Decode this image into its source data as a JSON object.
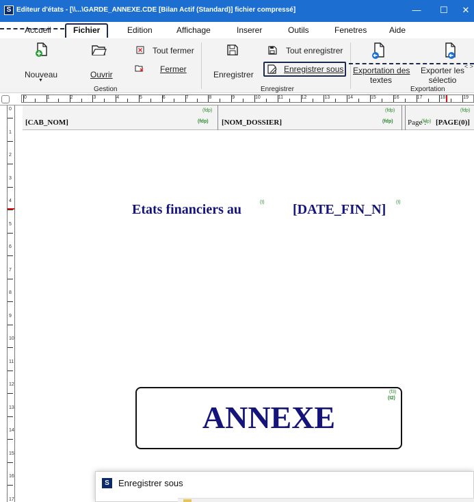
{
  "window": {
    "app_icon": "S",
    "title": "Editeur d'états - [\\\\...\\GARDE_ANNEXE.CDE [Bilan Actif (Standard)] fichier compressé]",
    "minimize": "—",
    "maximize": "☐",
    "close": "✕"
  },
  "menu": [
    "Accueil",
    "Fichier",
    "Edition",
    "Affichage",
    "Inserer",
    "Outils",
    "Fenetres",
    "Aide"
  ],
  "menu_active": "Fichier",
  "ribbon": {
    "gestion": {
      "nouveau": "Nouveau",
      "ouvrir": "Ouvrir",
      "tout_fermer": "Tout fermer",
      "fermer": "Fermer",
      "label": "Gestion"
    },
    "enregistrer": {
      "enregistrer": "Enregistrer",
      "tout_enregistrer": "Tout enregistrer",
      "enregistrer_sous": "Enregistrer sous",
      "label": "Enregistrer"
    },
    "exportation": {
      "exportation_des_textes_l1": "Exportation des",
      "exportation_des_textes_l2": "textes",
      "exporter_selection_l1": "Exporter les",
      "exporter_selection_l2": "sélectio",
      "label": "Exportation"
    },
    "scroll": "< >"
  },
  "ruler": {
    "h_numbers": [
      "0",
      "1",
      "2",
      "3",
      "4",
      "5",
      "6",
      "7",
      "8",
      "9",
      "10",
      "11",
      "12",
      "13",
      "14",
      "15",
      "16",
      "17",
      "18",
      "19"
    ],
    "v_numbers": [
      "0",
      "1",
      "2",
      "3",
      "4",
      "5",
      "6",
      "7",
      "8",
      "9",
      "10",
      "11",
      "12",
      "13",
      "14",
      "15",
      "16",
      "17"
    ]
  },
  "page": {
    "header": {
      "cab_nom": "[CAB_NOM]",
      "cab_tag_top": "(fdp)",
      "cab_tag_bottom": "(fdp)",
      "nom_dossier": "[NOM_DOSSIER]",
      "dossier_tag_top": "(fdp)",
      "dossier_tag_bottom": "(fdp)",
      "page_label": "Page :",
      "page_field": "[PAGE(0)]",
      "page_tag_top": "(fdp)",
      "page_tag_mid": "(fdp)"
    },
    "etats_label": "Etats financiers au",
    "etats_tag": "(t)",
    "date_field": "[DATE_FIN_N]",
    "date_tag": "(t)",
    "annexe": "ANNEXE",
    "annexe_tag1": "(f3)",
    "annexe_tag2": "(t2)"
  },
  "dialog": {
    "icon": "S",
    "title": "Enregistrer sous"
  },
  "colors": {
    "titlebar": "#1c6fd1",
    "title_text": "#14147a",
    "tag_green": "#2a8a2a",
    "highlight_border": "#1b2a4b"
  }
}
